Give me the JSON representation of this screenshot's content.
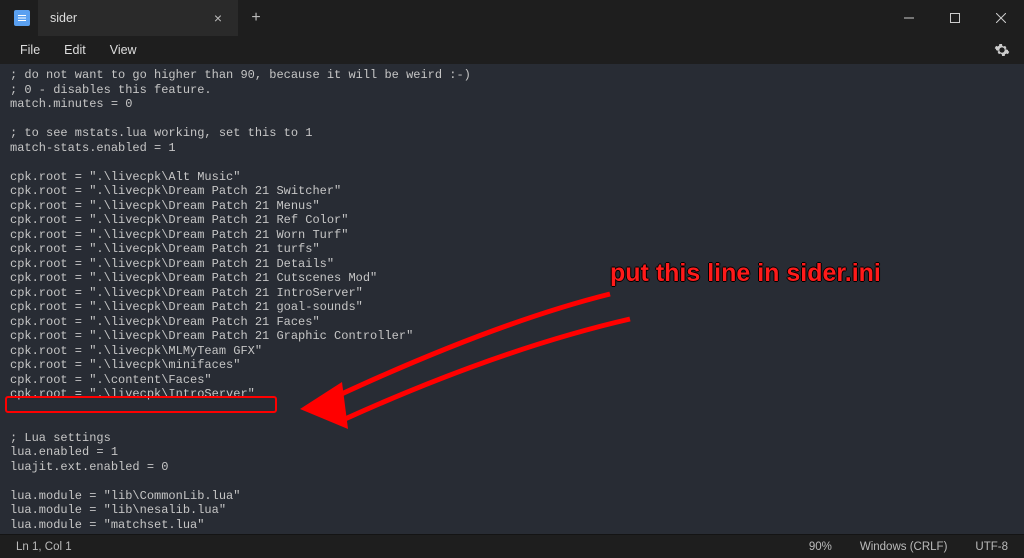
{
  "titlebar": {
    "tab_title": "sider"
  },
  "menubar": {
    "file": "File",
    "edit": "Edit",
    "view": "View"
  },
  "editor": {
    "lines": [
      "; do not want to go higher than 90, because it will be weird :-)",
      "; 0 - disables this feature.",
      "match.minutes = 0",
      "",
      "; to see mstats.lua working, set this to 1",
      "match-stats.enabled = 1",
      "",
      "cpk.root = \".\\livecpk\\Alt Music\"",
      "cpk.root = \".\\livecpk\\Dream Patch 21 Switcher\"",
      "cpk.root = \".\\livecpk\\Dream Patch 21 Menus\"",
      "cpk.root = \".\\livecpk\\Dream Patch 21 Ref Color\"",
      "cpk.root = \".\\livecpk\\Dream Patch 21 Worn Turf\"",
      "cpk.root = \".\\livecpk\\Dream Patch 21 turfs\"",
      "cpk.root = \".\\livecpk\\Dream Patch 21 Details\"",
      "cpk.root = \".\\livecpk\\Dream Patch 21 Cutscenes Mod\"",
      "cpk.root = \".\\livecpk\\Dream Patch 21 IntroServer\"",
      "cpk.root = \".\\livecpk\\Dream Patch 21 goal-sounds\"",
      "cpk.root = \".\\livecpk\\Dream Patch 21 Faces\"",
      "cpk.root = \".\\livecpk\\Dream Patch 21 Graphic Controller\"",
      "cpk.root = \".\\livecpk\\MLMyTeam GFX\"",
      "cpk.root = \".\\livecpk\\minifaces\"",
      "cpk.root = \".\\content\\Faces\"",
      "cpk.root = \".\\livecpk\\IntroServer\"",
      "",
      "",
      "; Lua settings",
      "lua.enabled = 1",
      "luajit.ext.enabled = 0",
      "",
      "lua.module = \"lib\\CommonLib.lua\"",
      "lua.module = \"lib\\nesalib.lua\"",
      "lua.module = \"matchset.lua\""
    ]
  },
  "annotation": {
    "text": "put this line in sider.ini"
  },
  "statusbar": {
    "pos": "Ln 1, Col 1",
    "zoom": "90%",
    "eol": "Windows (CRLF)",
    "encoding": "UTF-8"
  }
}
